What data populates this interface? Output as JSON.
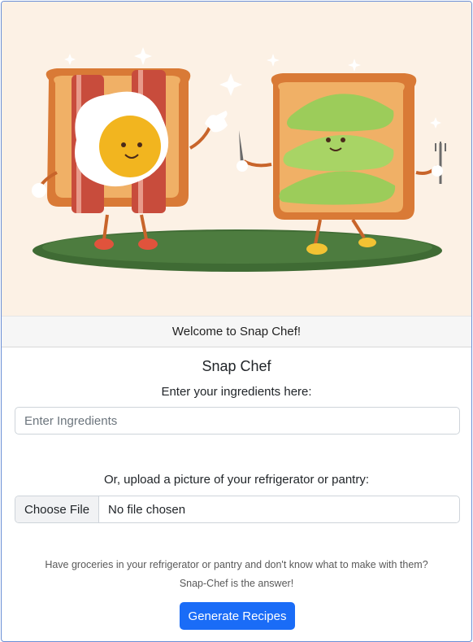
{
  "header": {
    "welcome_text": "Welcome to Snap Chef!"
  },
  "main": {
    "title": "Snap Chef",
    "ingredients_prompt": "Enter your ingredients here:",
    "ingredients_placeholder": "Enter Ingredients",
    "ingredients_value": "",
    "upload_prompt": "Or, upload a picture of your refrigerator or pantry:",
    "file_button_label": "Choose File",
    "file_status": "No file chosen",
    "description_line1": "Have groceries in your refrigerator or pantry and don't know what to make with them?",
    "description_line2": "Snap-Chef is the answer!",
    "generate_button_label": "Generate Recipes"
  },
  "colors": {
    "hero_background": "#fcf1e5",
    "primary_button": "#1a6cf7",
    "card_border": "#6b8fd6"
  }
}
